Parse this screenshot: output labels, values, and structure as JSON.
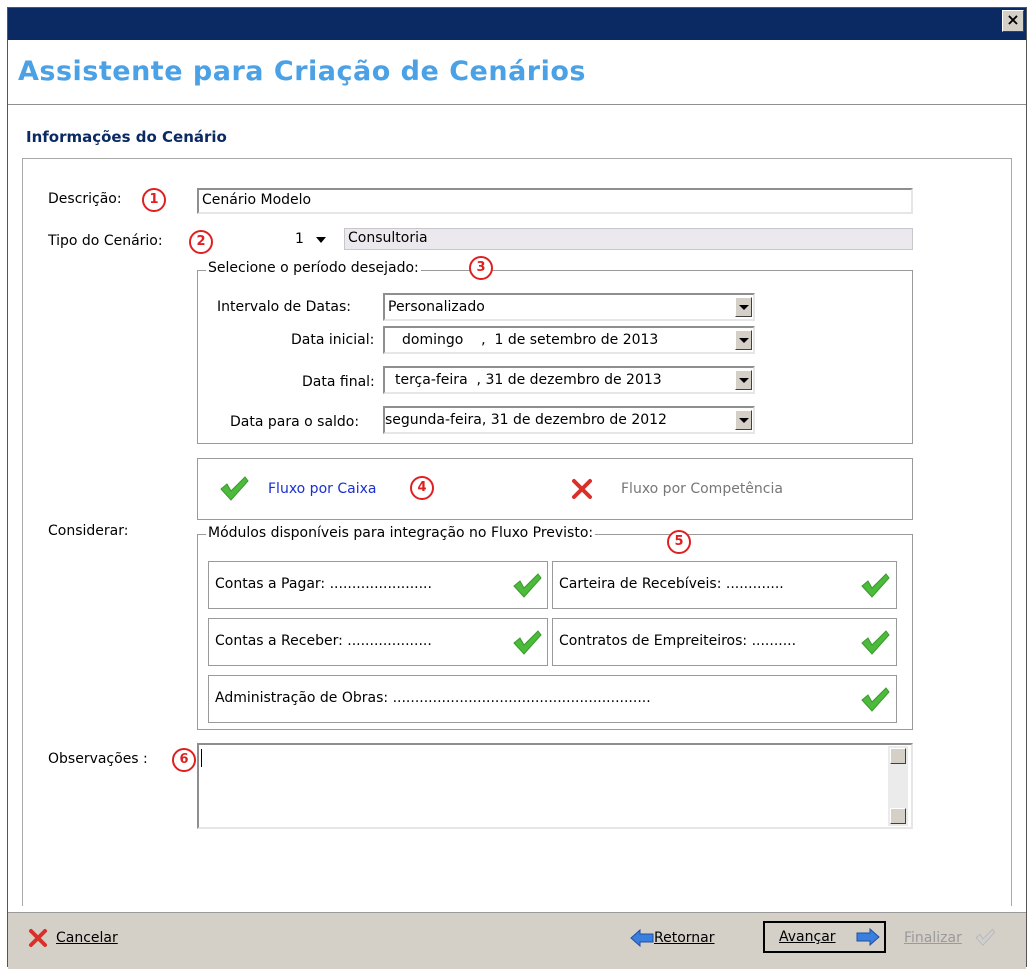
{
  "window": {
    "close_glyph": "×"
  },
  "header": {
    "title": "Assistente para Criação de Cenários",
    "section": "Informações do Cenário"
  },
  "form": {
    "descricao_label": "Descrição:",
    "descricao_value": "Cenário Modelo",
    "tipo_label": "Tipo do Cenário:",
    "tipo_code": "1",
    "tipo_name": "Consultoria",
    "periodo_legend": "Selecione o período desejado:",
    "intervalo_label": "Intervalo de Datas:",
    "intervalo_value": "Personalizado",
    "data_inicial_label": "Data inicial:",
    "data_inicial_value": "domingo    ,  1 de setembro de 2013",
    "data_final_label": "Data final:",
    "data_final_value": "terça-feira  , 31 de dezembro de 2013",
    "data_saldo_label": "Data para o saldo:",
    "data_saldo_value": "segunda-feira, 31 de dezembro de 2012",
    "considerar_label": "Considerar:",
    "fluxo_caixa": "Fluxo por Caixa",
    "fluxo_competencia": "Fluxo por Competência",
    "modulos_legend": "Módulos disponíveis para integração no Fluxo Previsto:",
    "modules": [
      "Contas a Pagar: .......................",
      "Carteira de Recebíveis: .............",
      "Contas a Receber: ...................",
      "Contratos de Empreiteiros: ..........",
      "Administração de Obras: .........................................................."
    ],
    "observacoes_label": "Observações :"
  },
  "markers": [
    "1",
    "2",
    "3",
    "4",
    "5",
    "6"
  ],
  "footer": {
    "cancel_label": "Cancelar",
    "back_label": "Retornar",
    "next_label": "Avançar",
    "finish_label": "Finalizar"
  },
  "colors": {
    "titlebar": "#0b2a63",
    "title": "#4aa1e6",
    "marker": "#e02020",
    "check": "#4cba3a",
    "link": "#1a2fd0"
  }
}
